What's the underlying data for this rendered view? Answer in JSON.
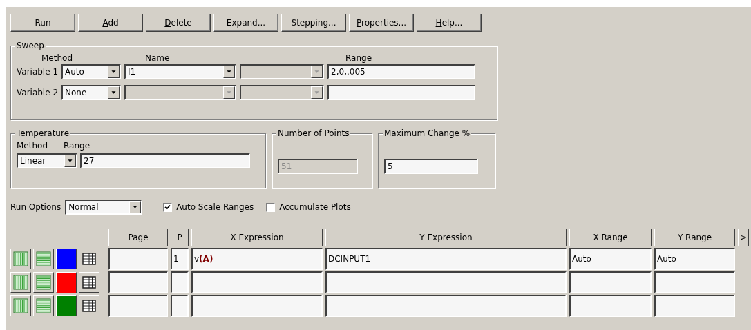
{
  "toolbar": [
    {
      "label": "Run"
    },
    {
      "label": "Add",
      "mnemonic": true
    },
    {
      "label": "Delete",
      "mnemonic": true
    },
    {
      "label": "Expand..."
    },
    {
      "label": "Stepping..."
    },
    {
      "label": "Properties...",
      "mnemonic": true
    },
    {
      "label": "Help...",
      "mnemonic": true
    }
  ],
  "sweep": {
    "title": "Sweep",
    "headers": {
      "method": "Method",
      "name": "Name",
      "range": "Range"
    },
    "variables": [
      {
        "label": "Variable 1",
        "method": "Auto",
        "name": "I1",
        "range": "2,0,.005",
        "name_disabled": false
      },
      {
        "label": "Variable 2",
        "method": "None",
        "name_disabled": true
      }
    ]
  },
  "temperature": {
    "title": "Temperature",
    "method_label": "Method",
    "range_label": "Range",
    "method": "Linear",
    "range": "27"
  },
  "number_of_points": {
    "title": "Number of Points",
    "value": "51",
    "disabled": true
  },
  "maximum_change": {
    "title": "Maximum Change %",
    "value": "5"
  },
  "run_options": {
    "label": "Run Options",
    "mnemonic": true,
    "value": "Normal"
  },
  "checkboxes": [
    {
      "label": "Auto Scale Ranges",
      "checked": true
    },
    {
      "label": "Accumulate Plots",
      "checked": false
    }
  ],
  "table": {
    "columns": [
      "Page",
      "P",
      "X Expression",
      "Y Expression",
      "X Range",
      "Y Range",
      ">"
    ],
    "rows": [
      {
        "color": "#0000ff",
        "p": "1",
        "x_expression": "v**(A)**",
        "y_expression": "DCINPUT1",
        "x_range": "Auto",
        "y_range": "Auto"
      },
      {
        "color": "#ff0000"
      },
      {
        "color": "#008000"
      }
    ]
  }
}
